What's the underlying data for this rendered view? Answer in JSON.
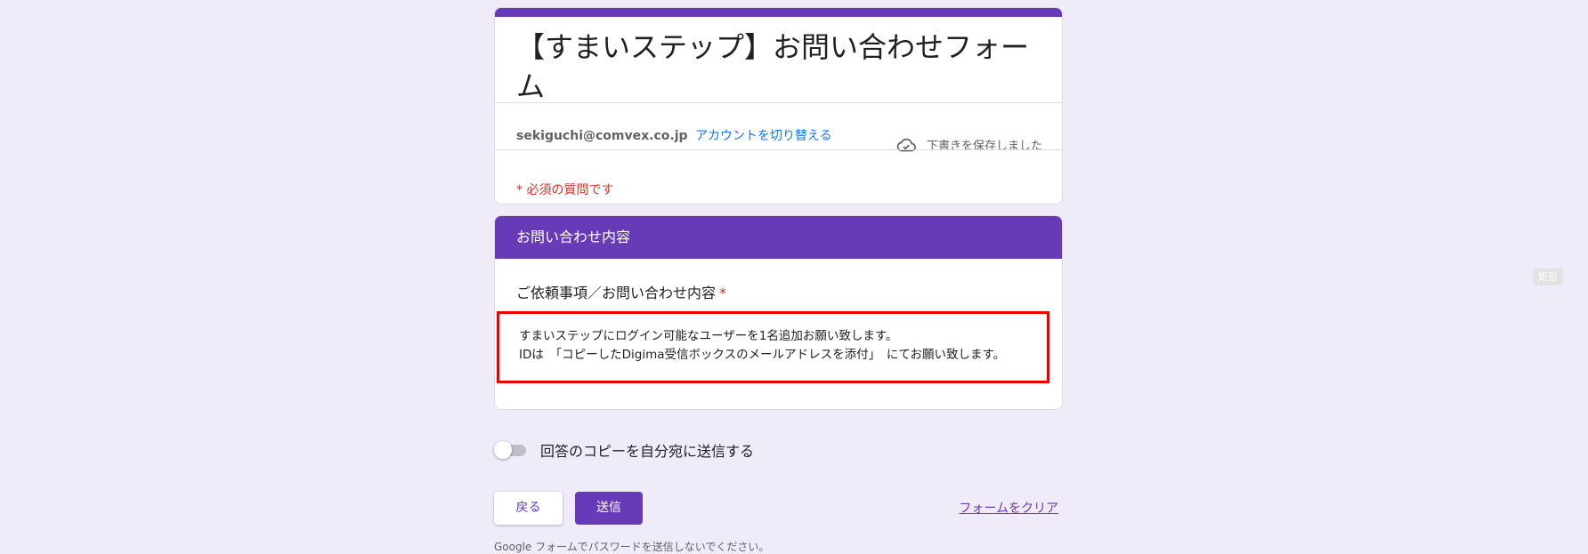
{
  "form": {
    "title": "【すまいステップ】お問い合わせフォーム",
    "account_email": "sekiguchi@comvex.co.jp",
    "switch_account": "アカウントを切り替える",
    "draft_status": "下書きを保存しました",
    "required_note": "* 必須の質問です"
  },
  "section": {
    "title": "お問い合わせ内容",
    "question": "ご依頼事項／お問い合わせ内容",
    "required_mark": "*",
    "answer_lines": [
      "すまいステップにログイン可能なユーザーを1名追加お願い致します。",
      "IDは　「コピーしたDigima受信ボックスのメールアドレスを添付」　にてお願い致します。"
    ]
  },
  "copy_toggle": {
    "label": "回答のコピーを自分宛に送信する",
    "enabled": false
  },
  "buttons": {
    "back": "戻る",
    "submit": "送信",
    "clear": "フォームをクリア"
  },
  "footer": {
    "note": "Google フォームでパスワードを送信しないでください。"
  },
  "side_badge": "矩形",
  "icons": {
    "draft": "cloud-check-icon"
  },
  "colors": {
    "accent": "#673ab7",
    "background": "#f0ebf8",
    "required": "#d93025",
    "link": "#1a73e8",
    "highlight_box": "#ee0000"
  }
}
